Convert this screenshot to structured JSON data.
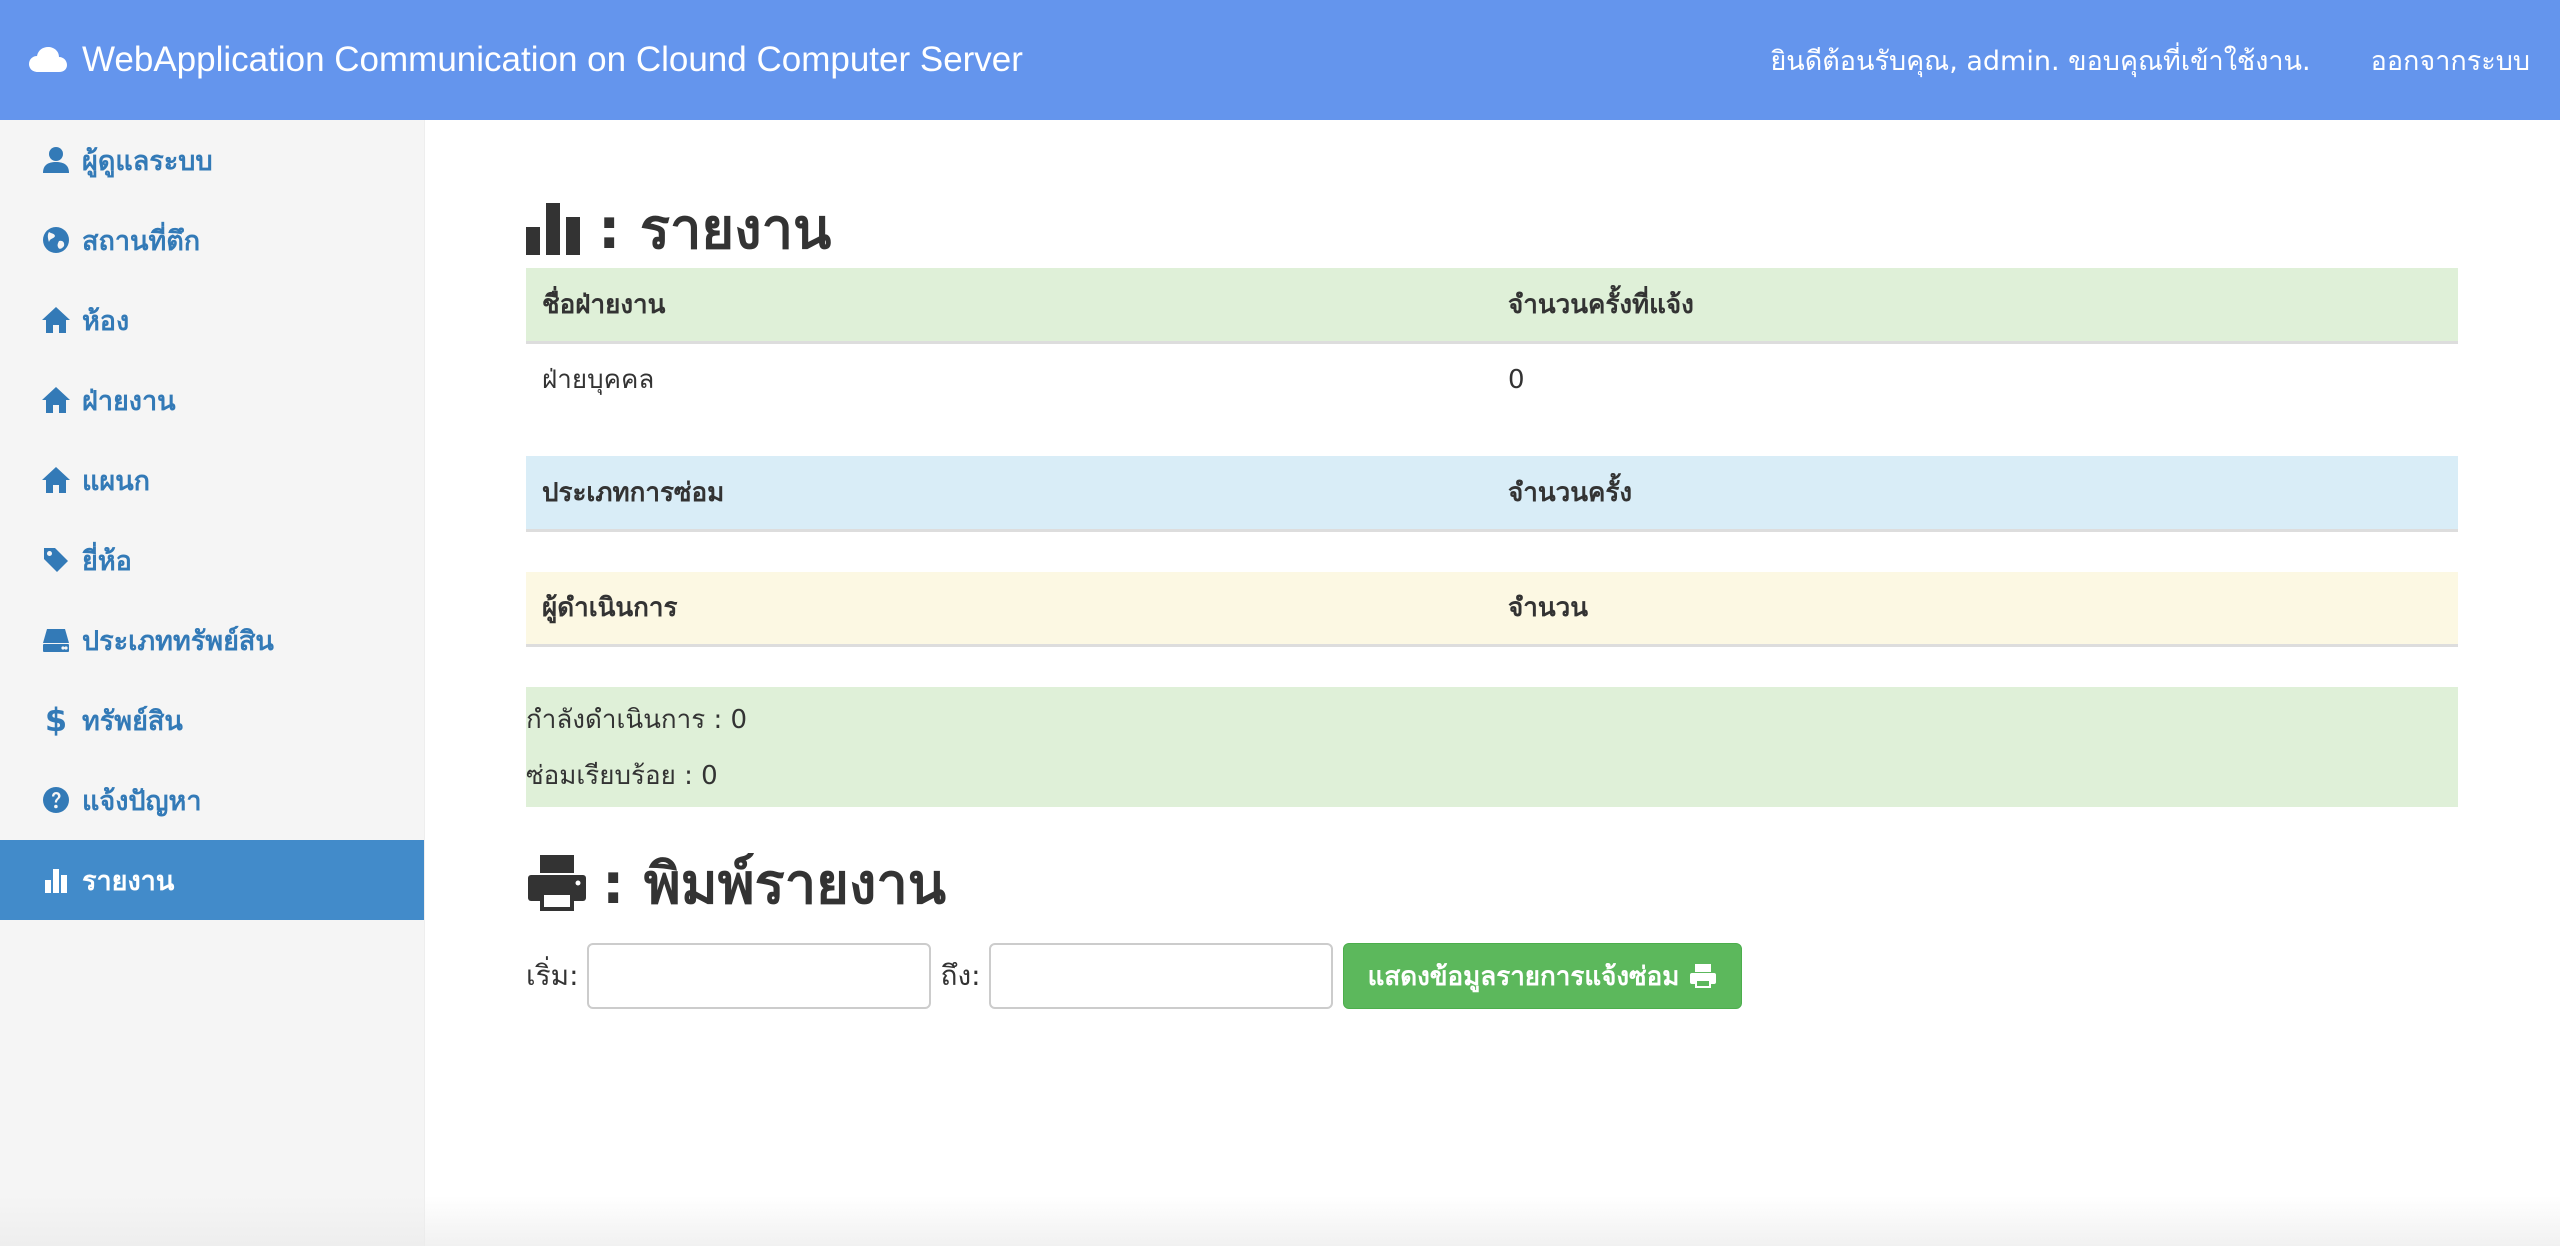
{
  "navbar": {
    "brand": "WebApplication Communication on Clound Computer Server",
    "welcome": "ยินดีต้อนรับคุณ, admin. ขอบคุณที่เข้าใช้งาน.",
    "logout": "ออกจากระบบ"
  },
  "sidebar": {
    "items": [
      {
        "label": "ผู้ดูแลระบบ",
        "icon": "user-icon"
      },
      {
        "label": "สถานที่ตึก",
        "icon": "globe-icon"
      },
      {
        "label": "ห้อง",
        "icon": "home-icon"
      },
      {
        "label": "ฝ่ายงาน",
        "icon": "home-icon"
      },
      {
        "label": "แผนก",
        "icon": "home-icon"
      },
      {
        "label": "ยี่ห้อ",
        "icon": "tag-icon"
      },
      {
        "label": "ประเภททรัพย์สิน",
        "icon": "hdd-icon"
      },
      {
        "label": "ทรัพย์สิน",
        "icon": "dollar-icon"
      },
      {
        "label": "แจ้งปัญหา",
        "icon": "question-icon"
      },
      {
        "label": "รายงาน",
        "icon": "stats-icon",
        "active": true
      }
    ]
  },
  "main": {
    "report_heading": ": รายงาน",
    "dept_table": {
      "headers": [
        "ชื่อฝ่ายงาน",
        "จำนวนครั้งที่แจ้ง"
      ],
      "rows": [
        [
          "ฝ่ายบุคคล",
          "0"
        ]
      ]
    },
    "repair_table": {
      "headers": [
        "ประเภทการซ่อม",
        "จำนวนครั้ง"
      ]
    },
    "operator_table": {
      "headers": [
        "ผู้ดำเนินการ",
        "จำนวน"
      ]
    },
    "status": {
      "in_progress": "กำลังดำเนินการ : 0",
      "done": "ซ่อมเรียบร้อย : 0"
    },
    "print_heading": ": พิมพ์รายงาน",
    "form": {
      "start_label": "เริ่ม:",
      "end_label": "ถึง:",
      "start_value": "",
      "end_value": "",
      "button_label": "แสดงข้อมูลรายการแจ้งซ่อม"
    }
  },
  "colors": {
    "navbar": "#6495ED",
    "active_menu": "#428bca",
    "link": "#337ab7",
    "success": "#dff0d8",
    "info": "#d9edf7",
    "warning": "#fcf8e3",
    "button": "#5cb85c"
  }
}
